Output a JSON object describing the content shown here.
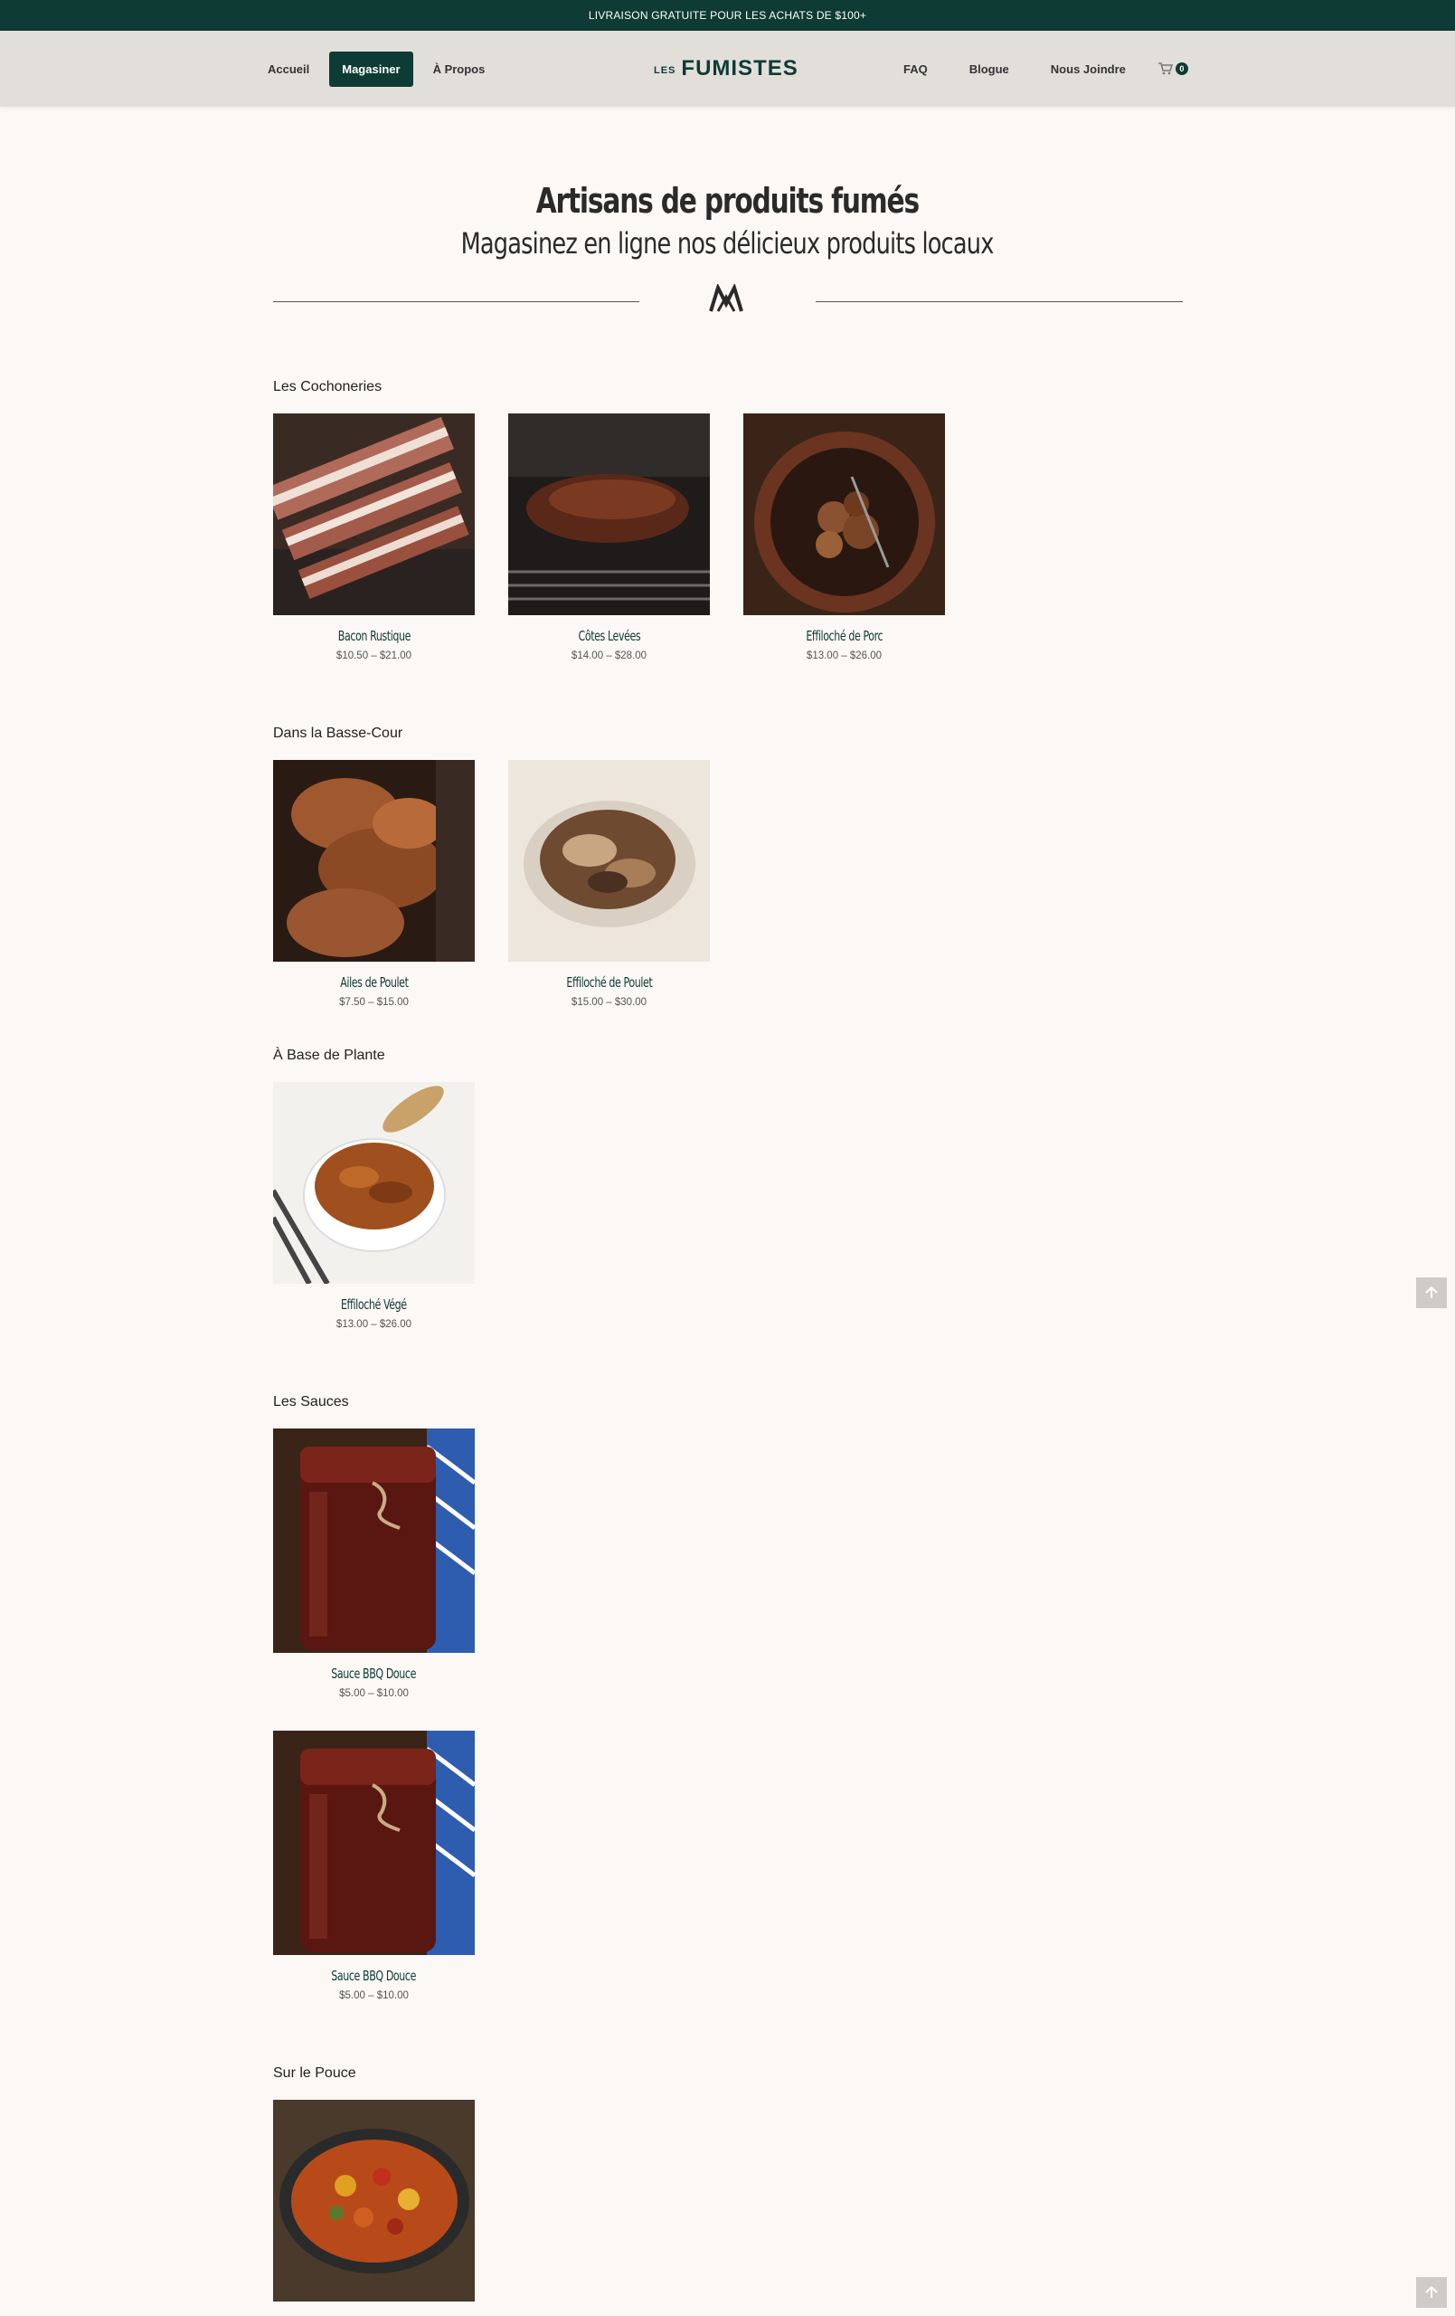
{
  "topbar": {
    "text": "LIVRAISON GRATUITE POUR LES ACHATS DE $100+"
  },
  "nav": {
    "left": [
      "Accueil",
      "Magasiner",
      "À Propos"
    ],
    "right": [
      "FAQ",
      "Blogue",
      "Nous Joindre"
    ],
    "active": "Magasiner",
    "cart_count": "0"
  },
  "logo": {
    "small": "LES",
    "big": "FUMISTES"
  },
  "hero": {
    "title": "Artisans de produits fumés",
    "subtitle": "Magasinez en ligne nos délicieux produits locaux"
  },
  "sections": [
    {
      "title": "Les Cochoneries",
      "products": [
        {
          "name": "Bacon Rustique",
          "price": "$10.50 – $21.00"
        },
        {
          "name": "Côtes Levées",
          "price": "$14.00 – $28.00"
        },
        {
          "name": "Effiloché de Porc",
          "price": "$13.00 – $26.00"
        }
      ]
    },
    {
      "title": "Dans la Basse-Cour",
      "products": [
        {
          "name": "Ailes de Poulet",
          "price": "$7.50 – $15.00"
        },
        {
          "name": "Effiloché de Poulet",
          "price": "$15.00 – $30.00"
        }
      ]
    },
    {
      "title": "À Base de Plante",
      "products": [
        {
          "name": "Effiloché Végé",
          "price": "$13.00 – $26.00"
        }
      ]
    },
    {
      "title": "Les Sauces",
      "products": [
        {
          "name": "Sauce BBQ Douce",
          "price": "$5.00 – $10.00"
        },
        {
          "name": "Sauce BBQ Douce",
          "price": "$5.00 – $10.00"
        }
      ]
    },
    {
      "title": "Sur le Pouce",
      "products": []
    }
  ],
  "colors": {
    "brand": "#0e3b34",
    "background": "#fcf8f5",
    "header": "#e2dfdb"
  },
  "icons": [
    "cart-icon",
    "fumistes-mark-icon",
    "arrow-up-icon"
  ]
}
